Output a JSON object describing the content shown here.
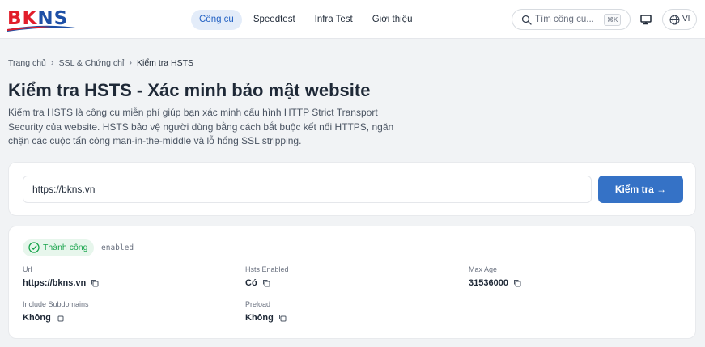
{
  "brand": {
    "logo_text_1": "BK",
    "logo_text_2": "NS"
  },
  "nav": {
    "items": [
      {
        "label": "Công cụ",
        "active": true
      },
      {
        "label": "Speedtest",
        "active": false
      },
      {
        "label": "Infra Test",
        "active": false
      },
      {
        "label": "Giới thiệu",
        "active": false
      }
    ]
  },
  "search": {
    "placeholder": "Tìm công cụ...",
    "shortcut": "⌘K"
  },
  "language": {
    "code": "VI"
  },
  "breadcrumb": [
    "Trang chủ",
    "SSL & Chứng chỉ",
    "Kiểm tra HSTS"
  ],
  "page": {
    "title": "Kiểm tra HSTS - Xác minh bảo mật website",
    "description": "Kiểm tra HSTS là công cụ miễn phí giúp bạn xác minh cấu hình HTTP Strict Transport Security của website. HSTS bảo vệ người dùng bằng cách bắt buộc kết nối HTTPS, ngăn chặn các cuộc tấn công man-in-the-middle và lỗ hổng SSL stripping."
  },
  "form": {
    "url_value": "https://bkns.vn",
    "submit_label": "Kiểm tra →"
  },
  "result": {
    "status_label": "Thành công",
    "status_code": "enabled",
    "fields": [
      {
        "label": "Url",
        "value": "https://bkns.vn"
      },
      {
        "label": "Hsts Enabled",
        "value": "Có"
      },
      {
        "label": "Max Age",
        "value": "31536000"
      },
      {
        "label": "Include Subdomains",
        "value": "Không"
      },
      {
        "label": "Preload",
        "value": "Không"
      }
    ]
  },
  "colors": {
    "primary": "#3572c6",
    "success": "#16a34a",
    "logo_red": "#e11d2a",
    "logo_blue": "#1d4fa6"
  }
}
